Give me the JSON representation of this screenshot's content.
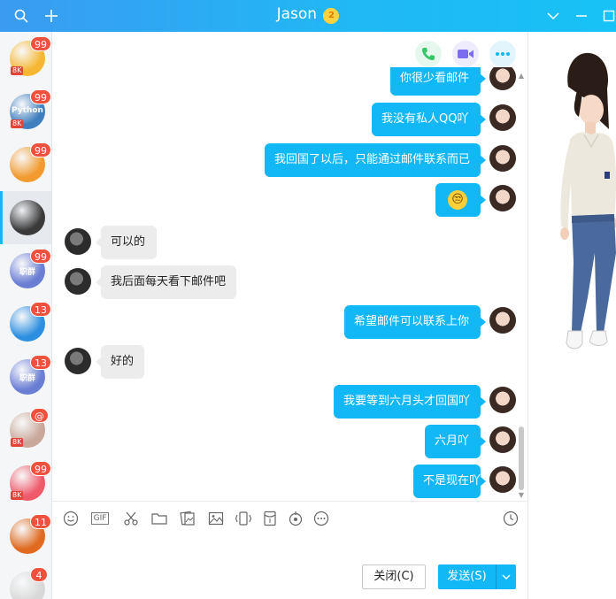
{
  "window": {
    "title": "Jason",
    "vip_badge": "2"
  },
  "sidebar": {
    "conversations": [
      {
        "badge": "99",
        "tag": "8K",
        "color": "#f5b731"
      },
      {
        "badge": "99",
        "tag": "8K",
        "color": "#3f7fbf",
        "caption": "Python"
      },
      {
        "badge": "99",
        "tag": "",
        "color": "#f29a2e"
      },
      {
        "badge": "",
        "tag": "",
        "color": "#3a3a3a",
        "active": true
      },
      {
        "badge": "99",
        "tag": "",
        "color": "#6a7fd4",
        "caption": "职群"
      },
      {
        "badge": "13",
        "tag": "",
        "color": "#2d8fe0"
      },
      {
        "badge": "13",
        "tag": "",
        "color": "#6a7fd4",
        "caption": "职群"
      },
      {
        "badge": "@",
        "tag": "8K",
        "color": "#c9a79a"
      },
      {
        "badge": "99",
        "tag": "8K",
        "color": "#ef5a6a"
      },
      {
        "badge": "11",
        "tag": "",
        "color": "#e06a1f"
      },
      {
        "badge": "4",
        "tag": "",
        "color": "#d8d8d8"
      }
    ]
  },
  "chat": {
    "messages": [
      {
        "side": "out",
        "text": "你很少看邮件",
        "partial": true
      },
      {
        "side": "out",
        "text": "我没有私人QQ吖"
      },
      {
        "side": "out",
        "text": "我回国了以后，只能通过邮件联系而已"
      },
      {
        "side": "out",
        "text": "",
        "emoji": "😒"
      },
      {
        "side": "in",
        "text": "可以的"
      },
      {
        "side": "in",
        "text": "我后面每天看下邮件吧"
      },
      {
        "side": "out",
        "text": "希望邮件可以联系上你"
      },
      {
        "side": "in",
        "text": "好的"
      },
      {
        "side": "out",
        "text": "我要等到六月头才回国吖"
      },
      {
        "side": "out",
        "text": "六月吖"
      },
      {
        "side": "out",
        "text": "不是现在吖"
      }
    ]
  },
  "toolbar": {
    "tools": [
      "emoji-icon",
      "gif-icon",
      "scissors-icon",
      "folder-icon",
      "image-folder-icon",
      "image-icon",
      "shake-icon",
      "red-packet-icon",
      "music-icon",
      "more-icon"
    ],
    "gif_label": "GIF"
  },
  "actions": {
    "close_label": "关闭(C)",
    "send_label": "发送(S)"
  },
  "colors": {
    "accent": "#12b7f5",
    "badge": "#f0513d",
    "phone": "#37c768",
    "video": "#7b6cf0",
    "more": "#12b7f5"
  }
}
